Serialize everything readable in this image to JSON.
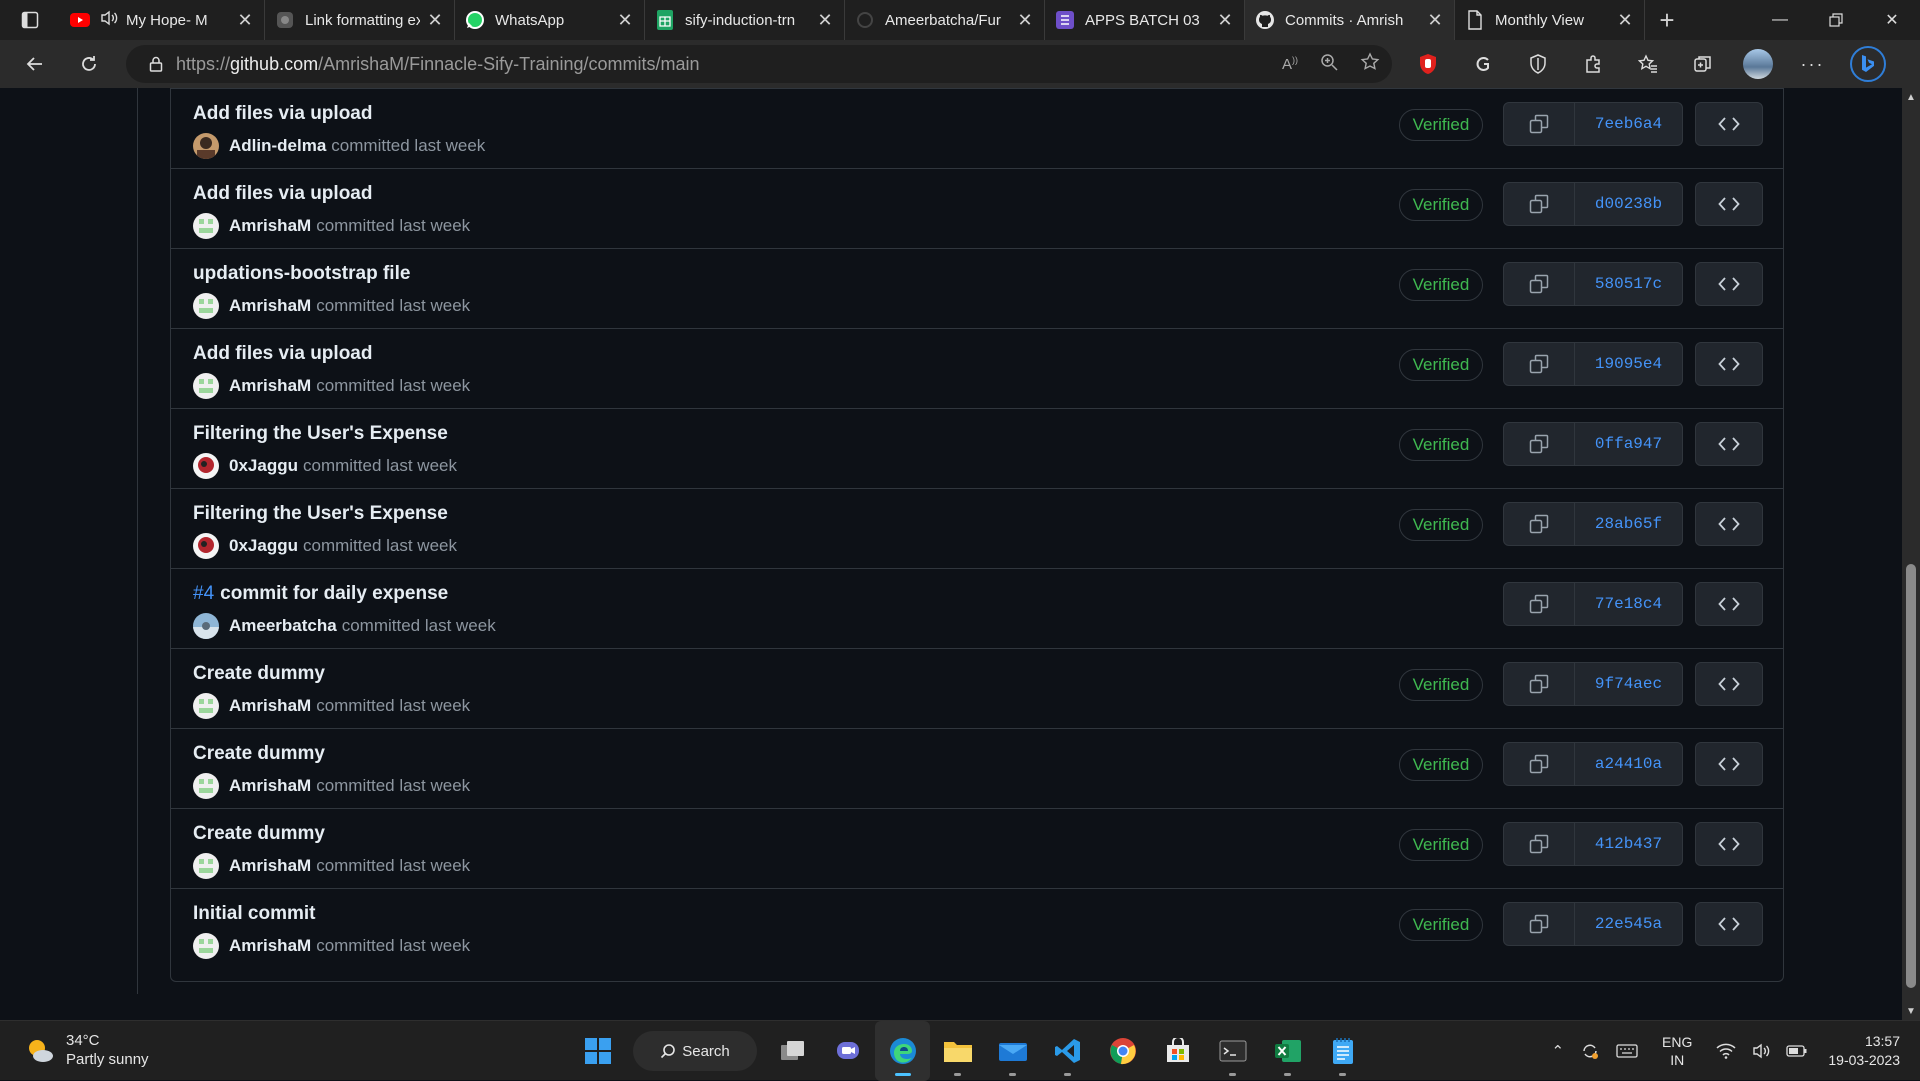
{
  "browser": {
    "tabs": [
      {
        "label": "My Hope- M",
        "icon": "youtube-icon",
        "audio": true
      },
      {
        "label": "Link formatting ex",
        "icon": "generic-site-icon"
      },
      {
        "label": "WhatsApp",
        "icon": "whatsapp-icon"
      },
      {
        "label": "sify-induction-trn",
        "icon": "sheets-icon"
      },
      {
        "label": "Ameerbatcha/Fur",
        "icon": "github-loading-icon"
      },
      {
        "label": "APPS BATCH 03",
        "icon": "forms-icon"
      },
      {
        "label": "Commits · Amrish",
        "icon": "github-icon",
        "active": true
      },
      {
        "label": "Monthly View",
        "icon": "page-icon"
      }
    ],
    "url_prefix": "https://",
    "url_host": "github.com",
    "url_path": "/AmrishaM/Finnacle-Sify-Training/commits/main"
  },
  "commits": [
    {
      "title": "Add files via upload",
      "issue": "",
      "author": "Adlin-delma",
      "when": "committed last week",
      "verified": "Verified",
      "sha": "7eeb6a4",
      "avatar": "photo-brown"
    },
    {
      "title": "Add files via upload",
      "issue": "",
      "author": "AmrishaM",
      "when": "committed last week",
      "verified": "Verified",
      "sha": "d00238b",
      "avatar": "identicon-green"
    },
    {
      "title": "updations-bootstrap file",
      "issue": "",
      "author": "AmrishaM",
      "when": "committed last week",
      "verified": "Verified",
      "sha": "580517c",
      "avatar": "identicon-green"
    },
    {
      "title": "Add files via upload",
      "issue": "",
      "author": "AmrishaM",
      "when": "committed last week",
      "verified": "Verified",
      "sha": "19095e4",
      "avatar": "identicon-green"
    },
    {
      "title": "Filtering the User's Expense",
      "issue": "",
      "author": "0xJaggu",
      "when": "committed last week",
      "verified": "Verified",
      "sha": "0ffa947",
      "avatar": "photo-red"
    },
    {
      "title": "Filtering the User's Expense",
      "issue": "",
      "author": "0xJaggu",
      "when": "committed last week",
      "verified": "Verified",
      "sha": "28ab65f",
      "avatar": "photo-red"
    },
    {
      "title": "commit for daily expense",
      "issue": "#4",
      "author": "Ameerbatcha",
      "when": "committed last week",
      "verified": "",
      "sha": "77e18c4",
      "avatar": "photo-sky"
    },
    {
      "title": "Create dummy",
      "issue": "",
      "author": "AmrishaM",
      "when": "committed last week",
      "verified": "Verified",
      "sha": "9f74aec",
      "avatar": "identicon-green"
    },
    {
      "title": "Create dummy",
      "issue": "",
      "author": "AmrishaM",
      "when": "committed last week",
      "verified": "Verified",
      "sha": "a24410a",
      "avatar": "identicon-green"
    },
    {
      "title": "Create dummy",
      "issue": "",
      "author": "AmrishaM",
      "when": "committed last week",
      "verified": "Verified",
      "sha": "412b437",
      "avatar": "identicon-green"
    },
    {
      "title": "Initial commit",
      "issue": "",
      "author": "AmrishaM",
      "when": "committed last week",
      "verified": "Verified",
      "sha": "22e545a",
      "avatar": "identicon-green"
    }
  ],
  "taskbar": {
    "temperature": "34°C",
    "weather": "Partly sunny",
    "search_label": "Search",
    "lang_top": "ENG",
    "lang_bottom": "IN",
    "time": "13:57",
    "date": "19-03-2023"
  },
  "colors": {
    "page_bg": "#0d1117",
    "border": "#30363d",
    "verified_green": "#3fb950",
    "link_blue": "#4493f8"
  }
}
